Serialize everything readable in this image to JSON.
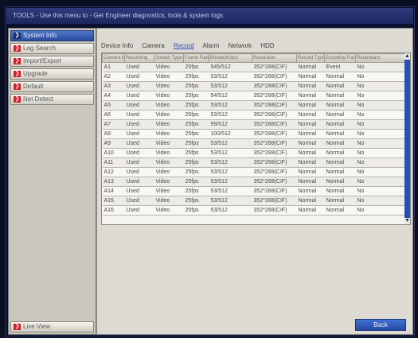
{
  "window": {
    "title": "TOOLS - Use this menu to - Get Engineer diagnostics, tools & system logs"
  },
  "sidebar": {
    "items": [
      {
        "label": "System Info",
        "active": true
      },
      {
        "label": "Log Search",
        "active": false
      },
      {
        "label": "Import/Export",
        "active": false
      },
      {
        "label": "Upgrade",
        "active": false
      },
      {
        "label": "Default",
        "active": false
      },
      {
        "label": "Net Detect",
        "active": false
      }
    ],
    "live_view_label": "Live View"
  },
  "tabs": [
    {
      "label": "Device Info",
      "active": false
    },
    {
      "label": "Camera",
      "active": false
    },
    {
      "label": "Record",
      "active": true
    },
    {
      "label": "Alarm",
      "active": false
    },
    {
      "label": "Network",
      "active": false
    },
    {
      "label": "HDD",
      "active": false
    }
  ],
  "table": {
    "columns": [
      "Camera No.",
      "Recording",
      "Stream Type",
      "Frame Rate",
      "Bitrate(Kbps)",
      "Resolution",
      "Record Type",
      "Encoding Parameters",
      "Redundant"
    ],
    "rows": [
      [
        "A1",
        "Used",
        "Video",
        "25fps",
        "545/512",
        "352*288(CIF)",
        "Normal",
        "Event",
        "No"
      ],
      [
        "A2",
        "Used",
        "Video",
        "25fps",
        "53/512",
        "352*288(CIF)",
        "Normal",
        "Normal",
        "No"
      ],
      [
        "A3",
        "Used",
        "Video",
        "25fps",
        "53/512",
        "352*288(CIF)",
        "Normal",
        "Normal",
        "No"
      ],
      [
        "A4",
        "Used",
        "Video",
        "25fps",
        "54/512",
        "352*288(CIF)",
        "Normal",
        "Normal",
        "No"
      ],
      [
        "A5",
        "Used",
        "Video",
        "25fps",
        "53/512",
        "352*288(CIF)",
        "Normal",
        "Normal",
        "No"
      ],
      [
        "A6",
        "Used",
        "Video",
        "25fps",
        "53/512",
        "352*288(CIF)",
        "Normal",
        "Normal",
        "No"
      ],
      [
        "A7",
        "Used",
        "Video",
        "25fps",
        "99/512",
        "352*288(CIF)",
        "Normal",
        "Normal",
        "No"
      ],
      [
        "A8",
        "Used",
        "Video",
        "25fps",
        "100/512",
        "352*288(CIF)",
        "Normal",
        "Normal",
        "No"
      ],
      [
        "A9",
        "Used",
        "Video",
        "25fps",
        "53/512",
        "352*288(CIF)",
        "Normal",
        "Normal",
        "No"
      ],
      [
        "A10",
        "Used",
        "Video",
        "25fps",
        "53/512",
        "352*288(CIF)",
        "Normal",
        "Normal",
        "No"
      ],
      [
        "A11",
        "Used",
        "Video",
        "25fps",
        "53/512",
        "352*288(CIF)",
        "Normal",
        "Normal",
        "No"
      ],
      [
        "A12",
        "Used",
        "Video",
        "25fps",
        "53/512",
        "352*288(CIF)",
        "Normal",
        "Normal",
        "No"
      ],
      [
        "A13",
        "Used",
        "Video",
        "25fps",
        "53/512",
        "352*288(CIF)",
        "Normal",
        "Normal",
        "No"
      ],
      [
        "A14",
        "Used",
        "Video",
        "25fps",
        "53/512",
        "352*288(CIF)",
        "Normal",
        "Normal",
        "No"
      ],
      [
        "A15",
        "Used",
        "Video",
        "25fps",
        "53/512",
        "352*288(CIF)",
        "Normal",
        "Normal",
        "No"
      ],
      [
        "A16",
        "Used",
        "Video",
        "25fps",
        "53/512",
        "352*288(CIF)",
        "Normal",
        "Normal",
        "No"
      ]
    ]
  },
  "back_label": "Back",
  "colors": {
    "accent": "#2b4d9c",
    "marker": "#d0202a",
    "scrollbar": "#2650b8"
  },
  "icons": {
    "menu_marker": "chevron-right-icon",
    "scroll_up": "chevron-up-icon",
    "scroll_down": "chevron-down-icon"
  }
}
